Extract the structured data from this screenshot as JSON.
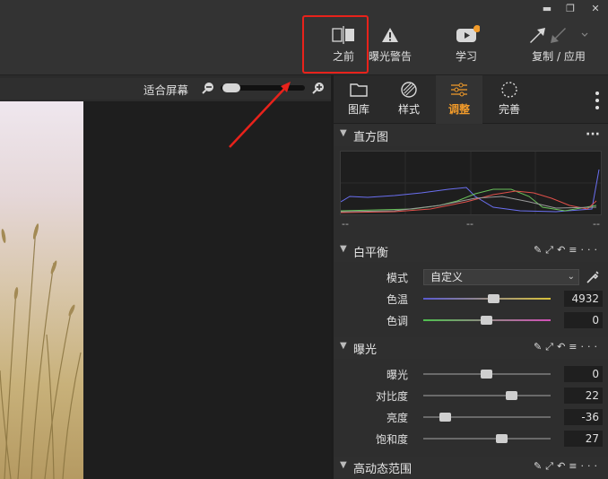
{
  "window": {
    "minimize": "▬",
    "maximize": "❐",
    "close": "✕"
  },
  "toolbar": {
    "before_label": "之前",
    "exposure_warning_label": "曝光警告",
    "learn_label": "学习",
    "copy_apply_label": "复制 / 应用"
  },
  "viewer": {
    "fit_label": "适合屏幕",
    "zoom_fraction": 0.12
  },
  "panel_tabs": [
    {
      "label": "图库",
      "icon": "folder-icon"
    },
    {
      "label": "样式",
      "icon": "styles-icon"
    },
    {
      "label": "调整",
      "icon": "adjust-sliders-icon"
    },
    {
      "label": "完善",
      "icon": "refine-icon"
    }
  ],
  "histogram": {
    "title": "直方图",
    "left_readout": "--",
    "mid_readout": "--",
    "right_readout": "--",
    "colors": {
      "red": "#e0504a",
      "green": "#69c15a",
      "blue": "#6a6ff0",
      "gray": "#9a9a9a"
    }
  },
  "white_balance": {
    "title": "白平衡",
    "mode_label": "模式",
    "mode_value": "自定义",
    "temp_label": "色温",
    "temp_value": "4932",
    "tint_label": "色调",
    "tint_value": "0"
  },
  "exposure": {
    "title": "曝光",
    "exposure_label": "曝光",
    "exposure_value": "0",
    "contrast_label": "对比度",
    "contrast_value": "22",
    "brightness_label": "亮度",
    "brightness_value": "-36",
    "saturation_label": "饱和度",
    "saturation_value": "27"
  },
  "hdr": {
    "title": "高动态范围"
  },
  "annotation": {
    "highlight_color": "#e8221b"
  }
}
